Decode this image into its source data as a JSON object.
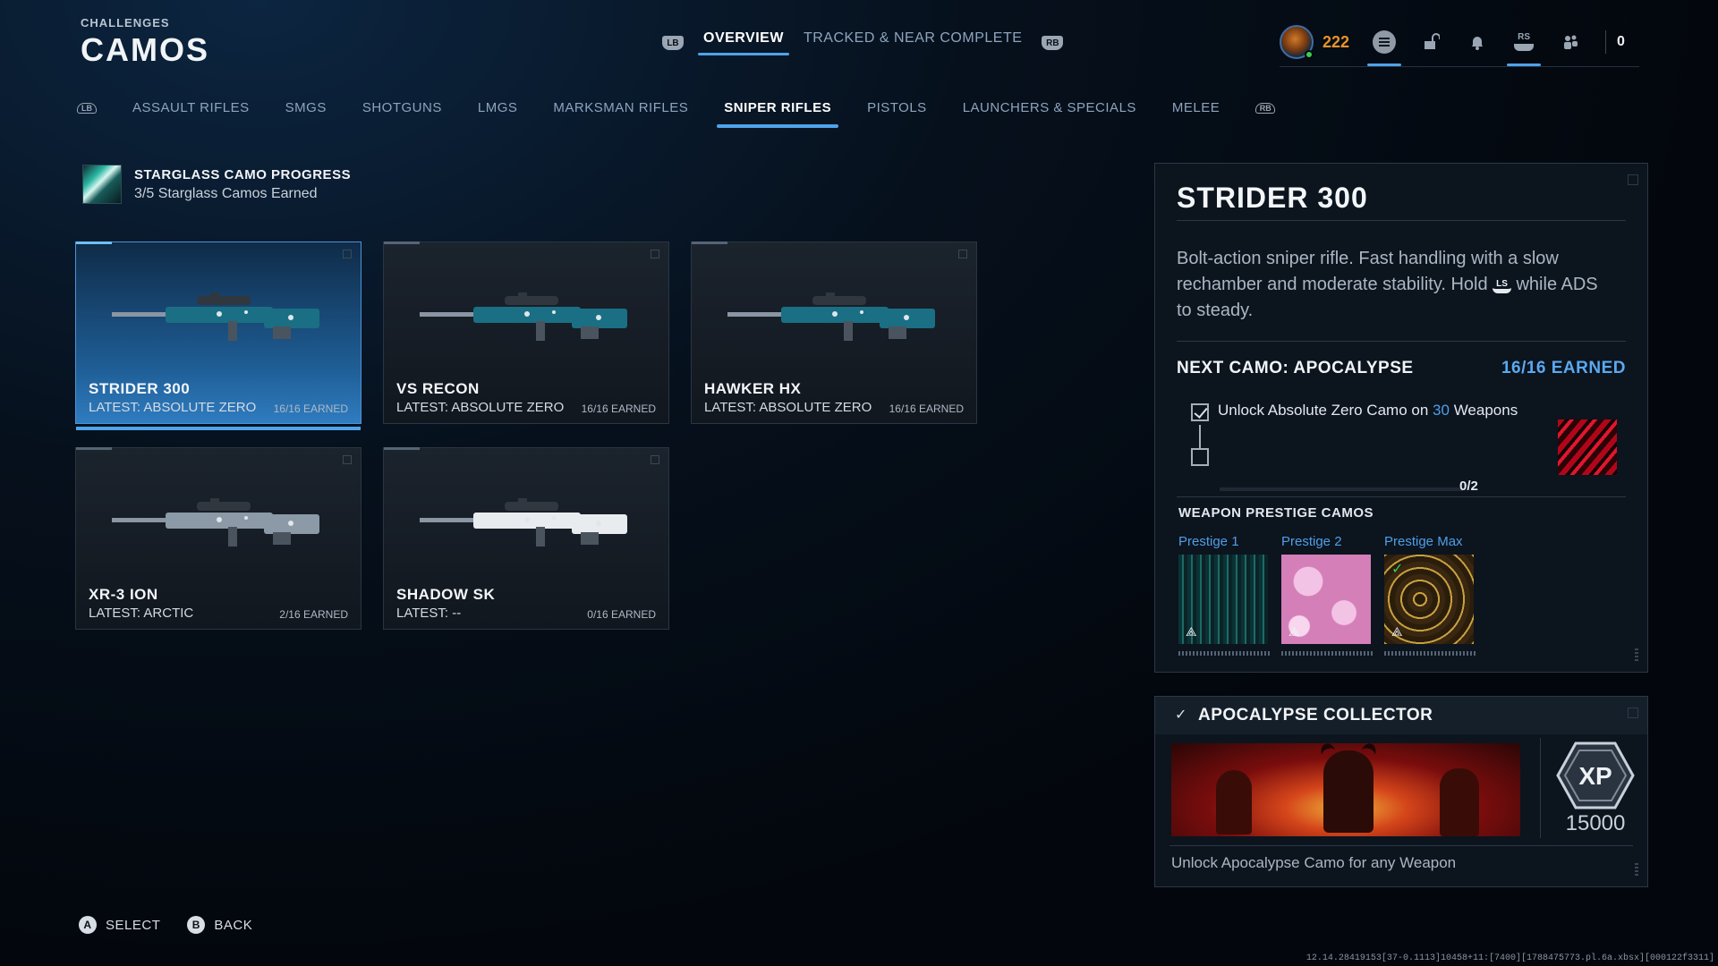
{
  "header": {
    "kicker": "CHALLENGES",
    "title": "CAMOS"
  },
  "top_tabs": {
    "lb": "LB",
    "rb": "RB",
    "items": [
      {
        "label": "OVERVIEW",
        "active": true
      },
      {
        "label": "TRACKED & NEAR COMPLETE",
        "active": false
      }
    ]
  },
  "status": {
    "cod_points": "222",
    "rs": "RS",
    "friends": "0"
  },
  "category_tabs": {
    "items": [
      "ASSAULT RIFLES",
      "SMGS",
      "SHOTGUNS",
      "LMGS",
      "MARKSMAN RIFLES",
      "SNIPER RIFLES",
      "PISTOLS",
      "LAUNCHERS & SPECIALS",
      "MELEE"
    ],
    "active": "SNIPER RIFLES"
  },
  "progress": {
    "title": "STARGLASS CAMO PROGRESS",
    "subtitle": "3/5 Starglass Camos Earned"
  },
  "weapons": [
    {
      "name": "STRIDER 300",
      "latest": "LATEST: ABSOLUTE ZERO",
      "earned": "16/16 EARNED",
      "selected": true,
      "camo": "#1a6f84",
      "fill": 1.0
    },
    {
      "name": "VS RECON",
      "latest": "LATEST: ABSOLUTE ZERO",
      "earned": "16/16 EARNED",
      "selected": false,
      "camo": "#1a6f84",
      "fill": 1.0
    },
    {
      "name": "HAWKER HX",
      "latest": "LATEST: ABSOLUTE ZERO",
      "earned": "16/16 EARNED",
      "selected": false,
      "camo": "#1a6f84",
      "fill": 1.0
    },
    {
      "name": "XR-3 ION",
      "latest": "LATEST: ARCTIC",
      "earned": "2/16 EARNED",
      "selected": false,
      "camo": "#8c99a6",
      "fill": 0.125
    },
    {
      "name": "SHADOW SK",
      "latest": "LATEST: --",
      "earned": "0/16 EARNED",
      "selected": false,
      "camo": "#e8ecef",
      "fill": 0
    }
  ],
  "detail": {
    "name": "STRIDER 300",
    "desc_a": "Bolt-action sniper rifle. Fast handling with a slow rechamber and moderate stability. Hold",
    "ls": "LS",
    "desc_b": "while ADS to steady.",
    "next_camo": "NEXT CAMO: APOCALYPSE",
    "next_earned": "16/16 EARNED",
    "task_a": "Unlock Absolute Zero Camo on",
    "task_num": "30",
    "task_b": "Weapons",
    "progress": "0/2",
    "progress_fraction": 0,
    "prestige_title": "WEAPON PRESTIGE CAMOS",
    "prestige": [
      {
        "label": "Prestige 1",
        "completed": false
      },
      {
        "label": "Prestige 2",
        "completed": false
      },
      {
        "label": "Prestige Max",
        "completed": true
      }
    ]
  },
  "reward": {
    "title": "APOCALYPSE COLLECTOR",
    "xp_label": "XP",
    "xp_value": "15000",
    "desc": "Unlock Apocalypse Camo for any Weapon"
  },
  "footer": {
    "select_key": "A",
    "select_label": "SELECT",
    "back_key": "B",
    "back_label": "BACK"
  },
  "build": "12.14.28419153[37-0.1113]10458+11:[7400][1788475773.pl.6a.xbsx][000122f3311]",
  "colors": {
    "accent": "#4fa3ea",
    "cod_points": "#e8922c",
    "online": "#3ccc4f"
  }
}
